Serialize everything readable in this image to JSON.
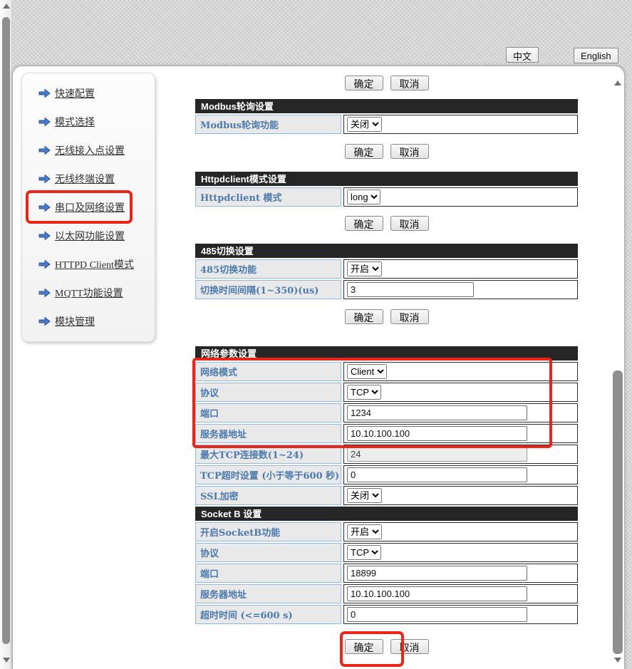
{
  "colors": {
    "annotation_red": "#e8261a",
    "section_header_bg": "#262626",
    "label_text": "#4d7aad",
    "link_text": "#333333"
  },
  "language": {
    "chinese": "中文",
    "english": "English"
  },
  "actions": {
    "ok": "确定",
    "cancel": "取消"
  },
  "sidebar": {
    "items": [
      {
        "label": "快速配置"
      },
      {
        "label": "模式选择"
      },
      {
        "label": "无线接入点设置"
      },
      {
        "label": "无线终端设置"
      },
      {
        "label": "串口及网络设置",
        "highlighted": true
      },
      {
        "label": "以太网功能设置"
      },
      {
        "label": "HTTPD Client模式"
      },
      {
        "label": "MQTT功能设置"
      },
      {
        "label": "模块管理"
      }
    ]
  },
  "modbus": {
    "title": "Modbus轮询设置",
    "rows": [
      {
        "label": "Modbus轮询功能",
        "value": "关闭"
      }
    ]
  },
  "httpd": {
    "title": "Httpdclient模式设置",
    "rows": [
      {
        "label": "Httpdclient 模式",
        "value": "long"
      }
    ]
  },
  "rs485": {
    "title": "485切换设置",
    "rows": [
      {
        "label": "485切换功能",
        "value": "开启"
      },
      {
        "label": "切换时间间隔(1~350)(us)",
        "value": "3"
      }
    ]
  },
  "net": {
    "title": "网络参数设置",
    "rows": [
      {
        "label": "网络模式",
        "value": "Client"
      },
      {
        "label": "协议",
        "value": "TCP"
      },
      {
        "label": "端口",
        "value": "1234"
      },
      {
        "label": "服务器地址",
        "value": "10.10.100.100"
      },
      {
        "label": "最大TCP连接数(1~24)",
        "value": "24",
        "disabled": true
      },
      {
        "label": "TCP超时设置 (小于等于600 秒)",
        "value": "0"
      },
      {
        "label": "SSL加密",
        "value": "关闭"
      }
    ]
  },
  "socketb": {
    "title": "Socket B 设置",
    "rows": [
      {
        "label": "开启SocketB功能",
        "value": "开启"
      },
      {
        "label": "协议",
        "value": "TCP"
      },
      {
        "label": "端口",
        "value": "18899"
      },
      {
        "label": "服务器地址",
        "value": "10.10.100.100"
      },
      {
        "label": "超时时间 (<=600 s)",
        "value": "0"
      }
    ]
  }
}
